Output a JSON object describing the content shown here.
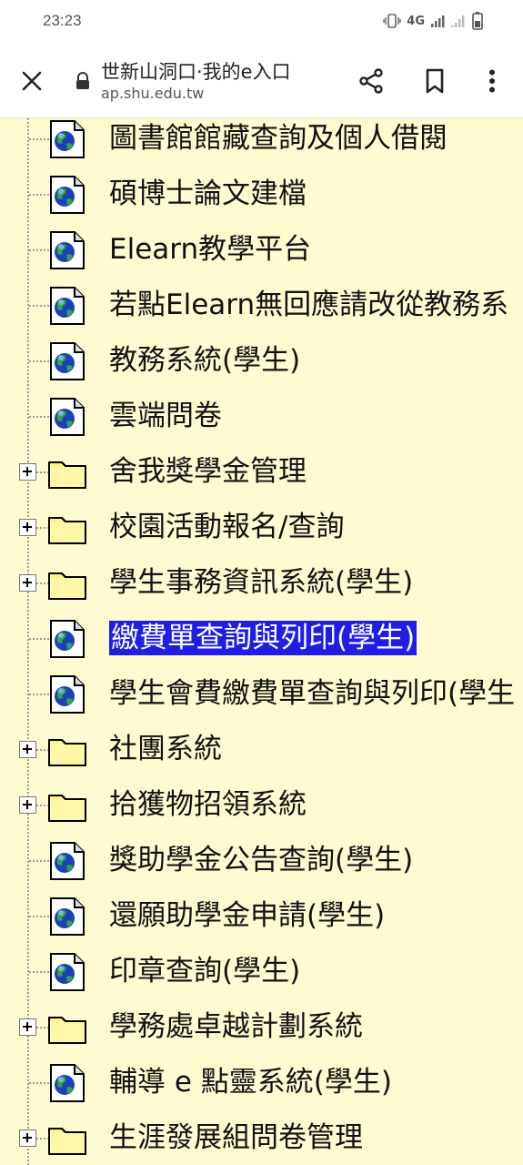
{
  "status_bar": {
    "time": "23:23",
    "network": "4G",
    "icons": [
      "vibrate-icon",
      "signal-icon",
      "signal-weak-icon",
      "battery-icon"
    ]
  },
  "browser": {
    "title": "世新山洞口·我的e入口",
    "url": "ap.shu.edu.tw",
    "icons": [
      "close-icon",
      "lock-icon",
      "share-icon",
      "bookmark-icon",
      "more-vert-icon"
    ]
  },
  "colors": {
    "page_background": "#FFFBD0",
    "selection": "#1E1EE6"
  },
  "tree": {
    "items": [
      {
        "label": "圖書館館藏查詢及個人借閱",
        "type": "page"
      },
      {
        "label": "碩博士論文建檔",
        "type": "page"
      },
      {
        "label": "Elearn教學平台",
        "type": "page"
      },
      {
        "label": "若點Elearn無回應請改從教務系",
        "type": "page"
      },
      {
        "label": "教務系統(學生)",
        "type": "page"
      },
      {
        "label": "雲端問卷",
        "type": "page"
      },
      {
        "label": "舍我獎學金管理",
        "type": "folder"
      },
      {
        "label": "校園活動報名/查詢",
        "type": "folder"
      },
      {
        "label": "學生事務資訊系統(學生)",
        "type": "folder"
      },
      {
        "label": "繳費單查詢與列印(學生)",
        "type": "page",
        "selected": true
      },
      {
        "label": "學生會費繳費單查詢與列印(學生",
        "type": "page"
      },
      {
        "label": "社團系統",
        "type": "folder"
      },
      {
        "label": "拾獲物招領系統",
        "type": "folder"
      },
      {
        "label": "獎助學金公告查詢(學生)",
        "type": "page"
      },
      {
        "label": "還願助學金申請(學生)",
        "type": "page"
      },
      {
        "label": "印章查詢(學生)",
        "type": "page"
      },
      {
        "label": "學務處卓越計劃系統",
        "type": "folder"
      },
      {
        "label": "輔導 e 點靈系統(學生)",
        "type": "page"
      },
      {
        "label": "生涯發展組問卷管理",
        "type": "folder"
      }
    ]
  }
}
